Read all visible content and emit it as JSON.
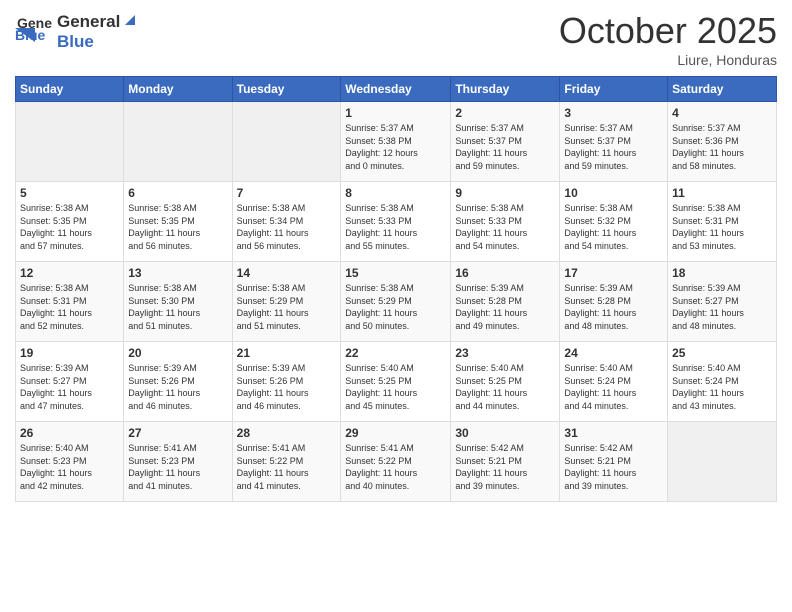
{
  "header": {
    "logo_general": "General",
    "logo_blue": "Blue",
    "month": "October 2025",
    "location": "Liure, Honduras"
  },
  "days_of_week": [
    "Sunday",
    "Monday",
    "Tuesday",
    "Wednesday",
    "Thursday",
    "Friday",
    "Saturday"
  ],
  "weeks": [
    [
      {
        "day": "",
        "info": ""
      },
      {
        "day": "",
        "info": ""
      },
      {
        "day": "",
        "info": ""
      },
      {
        "day": "1",
        "info": "Sunrise: 5:37 AM\nSunset: 5:38 PM\nDaylight: 12 hours\nand 0 minutes."
      },
      {
        "day": "2",
        "info": "Sunrise: 5:37 AM\nSunset: 5:37 PM\nDaylight: 11 hours\nand 59 minutes."
      },
      {
        "day": "3",
        "info": "Sunrise: 5:37 AM\nSunset: 5:37 PM\nDaylight: 11 hours\nand 59 minutes."
      },
      {
        "day": "4",
        "info": "Sunrise: 5:37 AM\nSunset: 5:36 PM\nDaylight: 11 hours\nand 58 minutes."
      }
    ],
    [
      {
        "day": "5",
        "info": "Sunrise: 5:38 AM\nSunset: 5:35 PM\nDaylight: 11 hours\nand 57 minutes."
      },
      {
        "day": "6",
        "info": "Sunrise: 5:38 AM\nSunset: 5:35 PM\nDaylight: 11 hours\nand 56 minutes."
      },
      {
        "day": "7",
        "info": "Sunrise: 5:38 AM\nSunset: 5:34 PM\nDaylight: 11 hours\nand 56 minutes."
      },
      {
        "day": "8",
        "info": "Sunrise: 5:38 AM\nSunset: 5:33 PM\nDaylight: 11 hours\nand 55 minutes."
      },
      {
        "day": "9",
        "info": "Sunrise: 5:38 AM\nSunset: 5:33 PM\nDaylight: 11 hours\nand 54 minutes."
      },
      {
        "day": "10",
        "info": "Sunrise: 5:38 AM\nSunset: 5:32 PM\nDaylight: 11 hours\nand 54 minutes."
      },
      {
        "day": "11",
        "info": "Sunrise: 5:38 AM\nSunset: 5:31 PM\nDaylight: 11 hours\nand 53 minutes."
      }
    ],
    [
      {
        "day": "12",
        "info": "Sunrise: 5:38 AM\nSunset: 5:31 PM\nDaylight: 11 hours\nand 52 minutes."
      },
      {
        "day": "13",
        "info": "Sunrise: 5:38 AM\nSunset: 5:30 PM\nDaylight: 11 hours\nand 51 minutes."
      },
      {
        "day": "14",
        "info": "Sunrise: 5:38 AM\nSunset: 5:29 PM\nDaylight: 11 hours\nand 51 minutes."
      },
      {
        "day": "15",
        "info": "Sunrise: 5:38 AM\nSunset: 5:29 PM\nDaylight: 11 hours\nand 50 minutes."
      },
      {
        "day": "16",
        "info": "Sunrise: 5:39 AM\nSunset: 5:28 PM\nDaylight: 11 hours\nand 49 minutes."
      },
      {
        "day": "17",
        "info": "Sunrise: 5:39 AM\nSunset: 5:28 PM\nDaylight: 11 hours\nand 48 minutes."
      },
      {
        "day": "18",
        "info": "Sunrise: 5:39 AM\nSunset: 5:27 PM\nDaylight: 11 hours\nand 48 minutes."
      }
    ],
    [
      {
        "day": "19",
        "info": "Sunrise: 5:39 AM\nSunset: 5:27 PM\nDaylight: 11 hours\nand 47 minutes."
      },
      {
        "day": "20",
        "info": "Sunrise: 5:39 AM\nSunset: 5:26 PM\nDaylight: 11 hours\nand 46 minutes."
      },
      {
        "day": "21",
        "info": "Sunrise: 5:39 AM\nSunset: 5:26 PM\nDaylight: 11 hours\nand 46 minutes."
      },
      {
        "day": "22",
        "info": "Sunrise: 5:40 AM\nSunset: 5:25 PM\nDaylight: 11 hours\nand 45 minutes."
      },
      {
        "day": "23",
        "info": "Sunrise: 5:40 AM\nSunset: 5:25 PM\nDaylight: 11 hours\nand 44 minutes."
      },
      {
        "day": "24",
        "info": "Sunrise: 5:40 AM\nSunset: 5:24 PM\nDaylight: 11 hours\nand 44 minutes."
      },
      {
        "day": "25",
        "info": "Sunrise: 5:40 AM\nSunset: 5:24 PM\nDaylight: 11 hours\nand 43 minutes."
      }
    ],
    [
      {
        "day": "26",
        "info": "Sunrise: 5:40 AM\nSunset: 5:23 PM\nDaylight: 11 hours\nand 42 minutes."
      },
      {
        "day": "27",
        "info": "Sunrise: 5:41 AM\nSunset: 5:23 PM\nDaylight: 11 hours\nand 41 minutes."
      },
      {
        "day": "28",
        "info": "Sunrise: 5:41 AM\nSunset: 5:22 PM\nDaylight: 11 hours\nand 41 minutes."
      },
      {
        "day": "29",
        "info": "Sunrise: 5:41 AM\nSunset: 5:22 PM\nDaylight: 11 hours\nand 40 minutes."
      },
      {
        "day": "30",
        "info": "Sunrise: 5:42 AM\nSunset: 5:21 PM\nDaylight: 11 hours\nand 39 minutes."
      },
      {
        "day": "31",
        "info": "Sunrise: 5:42 AM\nSunset: 5:21 PM\nDaylight: 11 hours\nand 39 minutes."
      },
      {
        "day": "",
        "info": ""
      }
    ]
  ]
}
